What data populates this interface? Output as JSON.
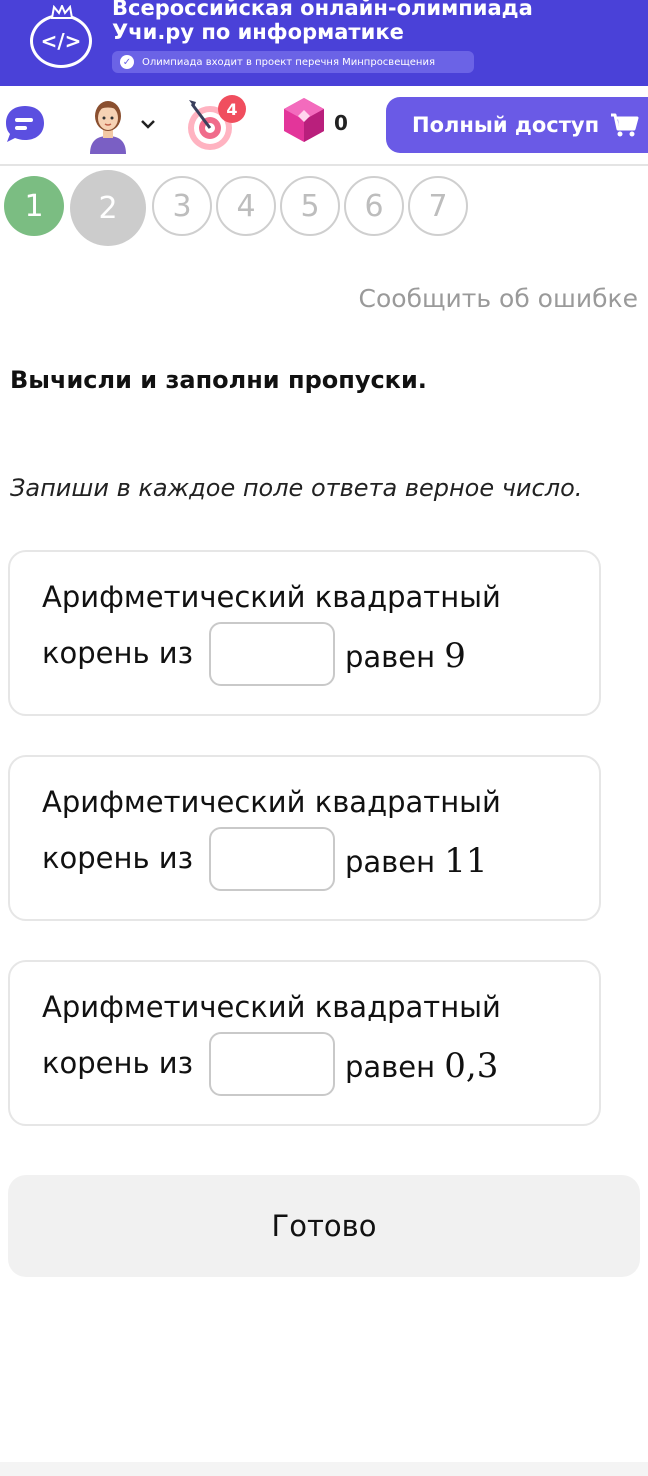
{
  "banner": {
    "logo_text": "</>",
    "title_line1": "Всероссийская онлайн-олимпиада",
    "title_line2": "Учи.ру по информатике",
    "note": "Олимпиада входит в проект перечня Минпросвещения"
  },
  "topbar": {
    "achievements_badge": "4",
    "gems_count": "0",
    "full_access_label": "Полный доступ"
  },
  "steps": [
    {
      "label": "1",
      "state": "done"
    },
    {
      "label": "2",
      "state": "current"
    },
    {
      "label": "3",
      "state": "todo"
    },
    {
      "label": "4",
      "state": "todo"
    },
    {
      "label": "5",
      "state": "todo"
    },
    {
      "label": "6",
      "state": "todo"
    },
    {
      "label": "7",
      "state": "todo"
    }
  ],
  "report_error": "Сообщить об ошибке",
  "task": {
    "title": "Вычисли и заполни пропуски.",
    "subtitle": "Запиши в каждое поле ответа верное число.",
    "items": [
      {
        "line1": "Арифметический квадратный",
        "prefix": "корень из",
        "suffix": "равен",
        "value": "9",
        "answer": ""
      },
      {
        "line1": "Арифметический квадратный",
        "prefix": "корень из",
        "suffix": "равен",
        "value": "11",
        "answer": ""
      },
      {
        "line1": "Арифметический квадратный",
        "prefix": "корень из",
        "suffix": "равен",
        "value": "0,3",
        "answer": ""
      }
    ]
  },
  "done_button": "Готово",
  "colors": {
    "banner": "#4a41d8",
    "accent": "#6a5ae6",
    "step_done": "#7bbd82",
    "step_current": "#cccccc",
    "badge": "#f04e5e"
  }
}
